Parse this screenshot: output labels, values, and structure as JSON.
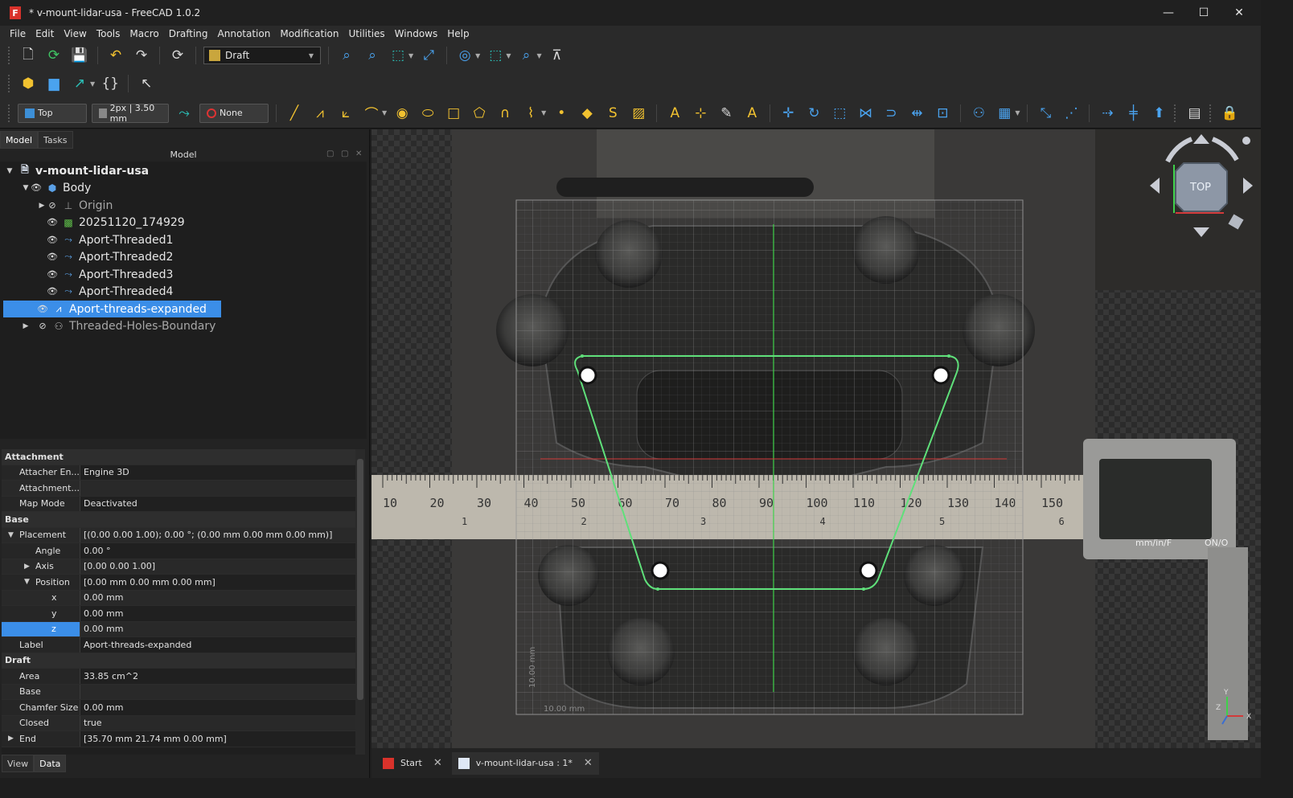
{
  "window": {
    "title": "* v-mount-lidar-usa - FreeCAD 1.0.2",
    "minimize": "—",
    "maximize": "☐",
    "close": "✕"
  },
  "menu": [
    "File",
    "Edit",
    "View",
    "Tools",
    "Macro",
    "Drafting",
    "Annotation",
    "Modification",
    "Utilities",
    "Windows",
    "Help"
  ],
  "toolbar": {
    "workbench": "Draft"
  },
  "draft_toolbar": {
    "working_plane": "Top",
    "style": "2px | 3.50 mm",
    "construction_group": "None"
  },
  "combo": {
    "tabs": [
      "Model",
      "Tasks"
    ],
    "header": "Model",
    "bottom_tabs": [
      "View",
      "Data"
    ]
  },
  "tree": [
    {
      "label": "v-mount-lidar-usa"
    },
    {
      "label": "Body"
    },
    {
      "label": "Origin"
    },
    {
      "label": "20251120_174929"
    },
    {
      "label": "Aport-Threaded1"
    },
    {
      "label": "Aport-Threaded2"
    },
    {
      "label": "Aport-Threaded3"
    },
    {
      "label": "Aport-Threaded4"
    },
    {
      "label": "Aport-threads-expanded"
    },
    {
      "label": "Threaded-Holes-Boundary"
    }
  ],
  "properties": {
    "groups": {
      "attachment": "Attachment",
      "base": "Base",
      "draft": "Draft"
    },
    "rows": {
      "attacher_engine": {
        "name": "Attacher En...",
        "value": "Engine 3D"
      },
      "attachment": {
        "name": "Attachment...",
        "value": ""
      },
      "map_mode": {
        "name": "Map Mode",
        "value": "Deactivated"
      },
      "placement": {
        "name": "Placement",
        "value": "[(0.00 0.00 1.00); 0.00 °; (0.00 mm  0.00 mm  0.00 mm)]"
      },
      "angle": {
        "name": "Angle",
        "value": "0.00 °"
      },
      "axis": {
        "name": "Axis",
        "value": "[0.00 0.00 1.00]"
      },
      "position": {
        "name": "Position",
        "value": "[0.00 mm  0.00 mm  0.00 mm]"
      },
      "x": {
        "name": "x",
        "value": "0.00 mm"
      },
      "y": {
        "name": "y",
        "value": "0.00 mm"
      },
      "z": {
        "name": "z",
        "value": "0.00 mm"
      },
      "label": {
        "name": "Label",
        "value": "Aport-threads-expanded"
      },
      "area": {
        "name": "Area",
        "value": "33.85 cm^2"
      },
      "base": {
        "name": "Base",
        "value": ""
      },
      "chamfer": {
        "name": "Chamfer Size",
        "value": "0.00 mm"
      },
      "closed": {
        "name": "Closed",
        "value": "true"
      },
      "end": {
        "name": "End",
        "value": "[35.70 mm  21.74 mm  0.00 mm]"
      }
    }
  },
  "view3d": {
    "navcube_face": "TOP",
    "grid_label_x": "10.00 mm",
    "grid_label_y": "10.00 mm",
    "ruler_numbers": [
      "10",
      "20",
      "30",
      "40",
      "50",
      "60",
      "70",
      "80",
      "90",
      "100",
      "110",
      "120",
      "130",
      "140",
      "150"
    ],
    "ruler_inches": [
      "1",
      "2",
      "3",
      "4",
      "5",
      "6"
    ],
    "caliper_label_1": "mm/in/F",
    "caliper_label_2": "ON/O",
    "axis_labels": [
      "Y",
      "Z",
      "X"
    ],
    "colors": {
      "wire": "#5fe07a",
      "grid": "#8a8a8a",
      "axis_green": "#3fd14a",
      "axis_red": "#d23a3a"
    }
  },
  "doc_tabs": [
    {
      "label": "Start"
    },
    {
      "label": "v-mount-lidar-usa : 1*"
    }
  ]
}
